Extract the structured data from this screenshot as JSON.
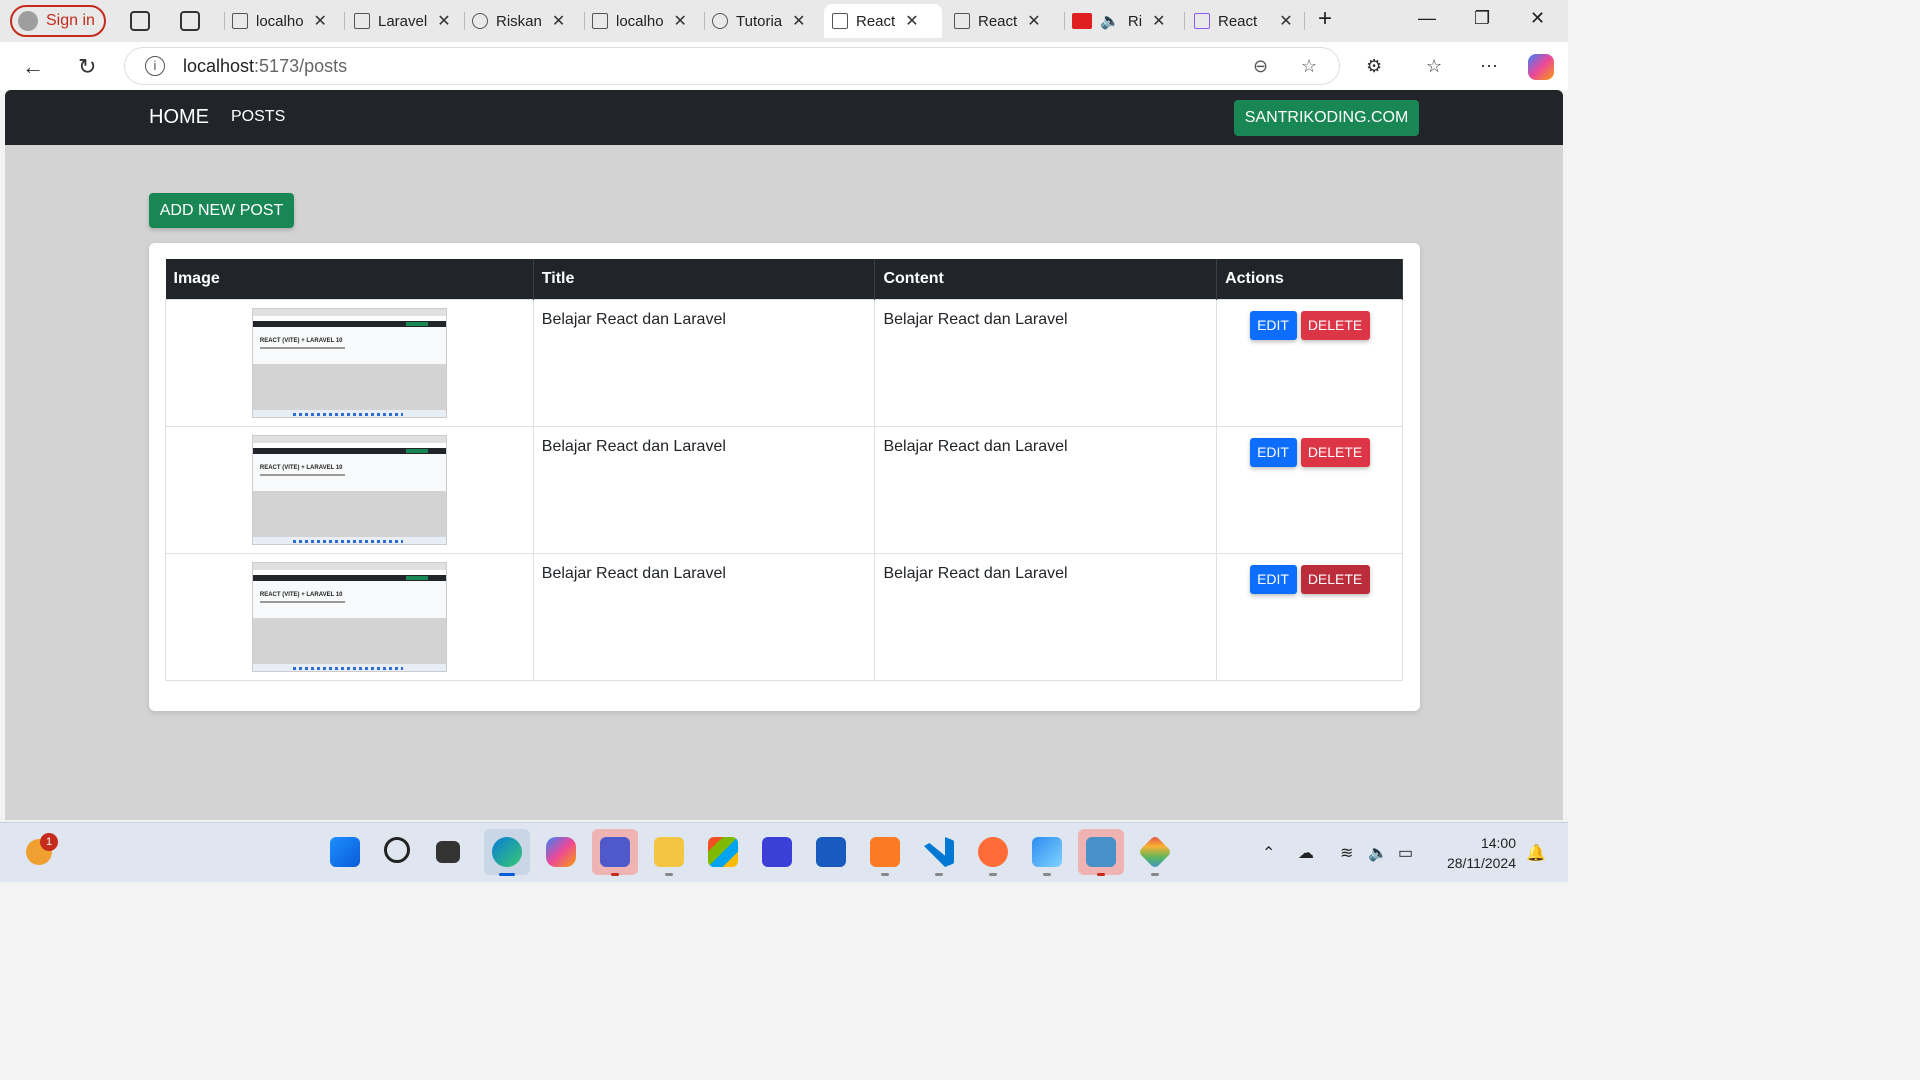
{
  "browser": {
    "signin_label": "Sign in",
    "tabs": [
      {
        "label": "localho",
        "active": false
      },
      {
        "label": "Laravel",
        "active": false
      },
      {
        "label": "Riskan",
        "active": false
      },
      {
        "label": "localho",
        "active": false
      },
      {
        "label": "Tutoria",
        "active": false
      },
      {
        "label": "React",
        "active": true
      },
      {
        "label": "React",
        "active": false
      },
      {
        "label": "Ri",
        "active": false
      },
      {
        "label": "React",
        "active": false
      }
    ],
    "close_glyph": "✕",
    "new_tab_glyph": "+",
    "url_host": "localhost",
    "url_rest": ":5173/posts"
  },
  "app": {
    "brand": "HOME",
    "nav_posts": "POSTS",
    "site_button": "SANTRIKODING.COM",
    "add_button": "ADD NEW POST",
    "table": {
      "headers": [
        "Image",
        "Title",
        "Content",
        "Actions"
      ],
      "rows": [
        {
          "title": "Belajar React dan Laravel",
          "content": "Belajar React dan Laravel"
        },
        {
          "title": "Belajar React dan Laravel",
          "content": "Belajar React dan Laravel"
        },
        {
          "title": "Belajar React dan Laravel",
          "content": "Belajar React dan Laravel"
        }
      ],
      "edit_label": "EDIT",
      "delete_label": "DELETE"
    },
    "thumbnail": {
      "title": "REACT (VITE) + LARAVEL 10"
    },
    "colors": {
      "navbar": "#212529",
      "success": "#198754",
      "primary": "#0d6efd",
      "danger": "#dc3545"
    }
  },
  "taskbar": {
    "weather_badge": "1",
    "time": "14:00",
    "date": "28/11/2024",
    "apps": [
      "start-icon",
      "search-icon",
      "task-view-icon",
      "edge-icon",
      "copilot-icon",
      "teams-icon",
      "file-explorer-icon",
      "store-icon",
      "app-icon",
      "word-icon",
      "xampp-icon",
      "vscode-icon",
      "postman-icon",
      "photos-icon",
      "remote-desktop-icon",
      "git-icon"
    ]
  }
}
